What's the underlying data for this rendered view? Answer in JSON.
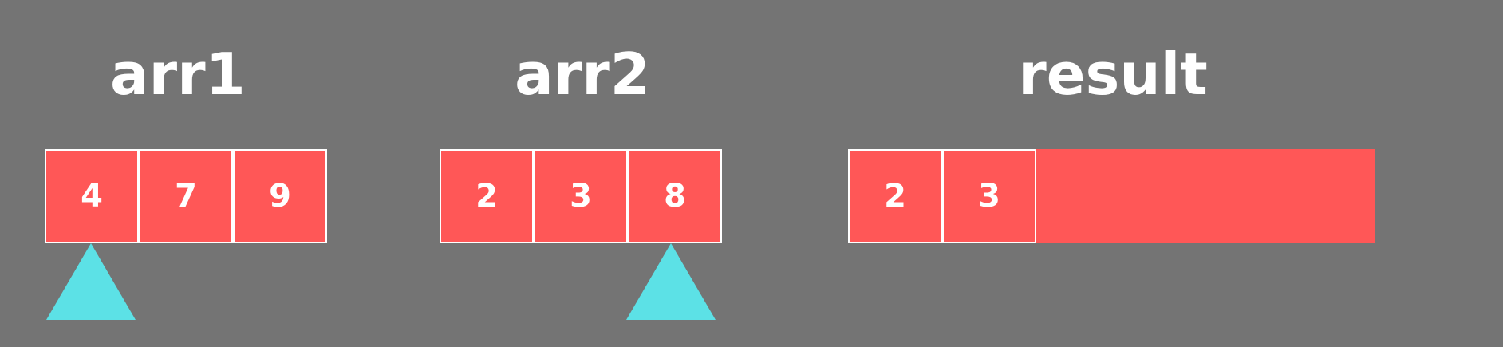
{
  "arr1": {
    "label": "arr1",
    "values": [
      "4",
      "7",
      "9"
    ],
    "pointer_index": 0
  },
  "arr2": {
    "label": "arr2",
    "values": [
      "2",
      "3",
      "8"
    ],
    "pointer_index": 2
  },
  "result": {
    "label": "result",
    "values": [
      "2",
      "3"
    ]
  },
  "colors": {
    "background": "#747474",
    "cell": "#ff5757",
    "cell_border": "#ffffff",
    "text": "#ffffff",
    "pointer": "#5ce1e6"
  }
}
